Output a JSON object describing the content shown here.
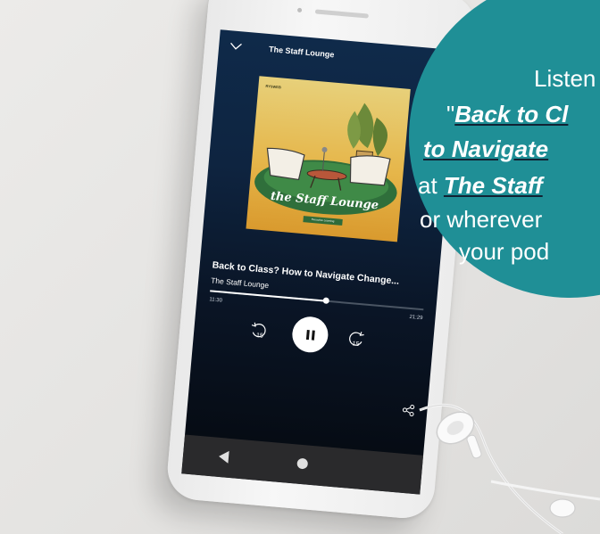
{
  "player": {
    "header_show": "The Staff Lounge",
    "artwork": {
      "badge": "RYSWEB",
      "title": "the Staff Lounge",
      "tag": "Executive Learning"
    },
    "episode_title": "Back to Class? How to Navigate Change...",
    "show_name": "The Staff Lounge",
    "progress": 0.54,
    "time_elapsed": "11:30",
    "time_total": "21:29",
    "rewind_label": "15",
    "forward_label": "15"
  },
  "promo": {
    "line1": "Listen",
    "line2_quote": "\"",
    "line2_link": "Back to Cl",
    "line3_link": "to Navigate",
    "line4_prefix": "at ",
    "line4_link": "The Staff",
    "line5": "or wherever",
    "line6": "your pod"
  },
  "colors": {
    "teal": "#1f8f96",
    "screen_top": "#0f2a4a",
    "art_gold": "#e6b64a"
  }
}
